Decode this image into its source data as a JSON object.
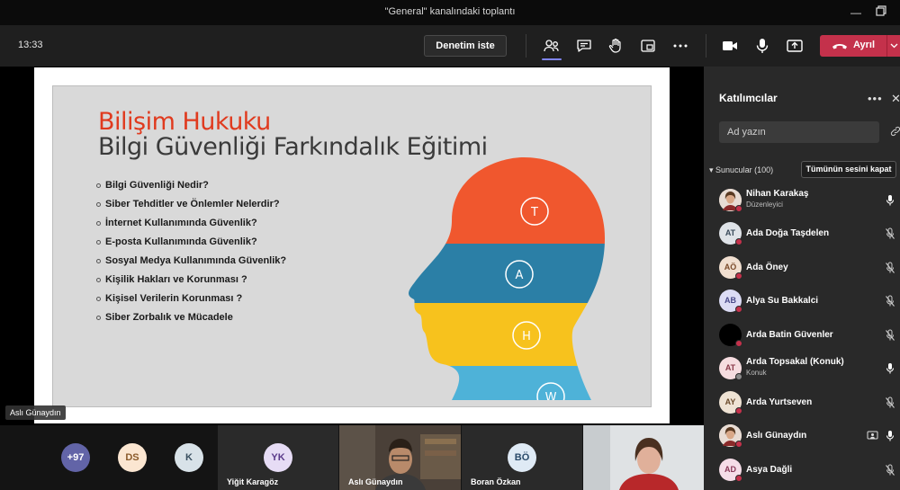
{
  "window": {
    "title": "\"General\" kanalındaki toplantı"
  },
  "toolbar": {
    "time": "13:33",
    "request_control": "Denetim iste",
    "leave": "Ayrıl"
  },
  "slide": {
    "title_line1": "Bilişim Hukuku",
    "title_line2": "Bilgi Güvenliği Farkındalık Eğitimi",
    "bullets": [
      "Bilgi Güvenliği Nedir?",
      "Siber Tehditler ve Önlemler Nelerdir?",
      "İnternet Kullanımında Güvenlik?",
      "E-posta Kullanımında Güvenlik?",
      "Sosyal Medya Kullanımında Güvenlik?",
      "Kişilik Hakları ve Korunması ?",
      "Kişisel Verilerin Korunması ?",
      "Siber Zorbalık ve Mücadele"
    ],
    "letters": [
      "T",
      "A",
      "H",
      "W"
    ],
    "colors": [
      "#f0572e",
      "#2b7fa6",
      "#f7c21d",
      "#4eb2d8"
    ]
  },
  "presenter_label": "Aslı Günaydın",
  "gallery": {
    "overflow": "+97",
    "ds": "DS",
    "k": "K",
    "tiles": [
      {
        "initials": "YK",
        "name": "Yiğit Karagöz"
      },
      {
        "initials": "",
        "name": "Aslı Günaydın"
      },
      {
        "initials": "BÖ",
        "name": "Boran Özkan"
      }
    ]
  },
  "panel": {
    "title": "Katılımcılar",
    "search_placeholder": "Ad yazın",
    "section": "Sunucular (100)",
    "mute_all": "Tümünün sesini kapat",
    "participants": [
      {
        "initials": "",
        "name": "Nihan Karakaş",
        "sub": "Düzenleyici",
        "bg": "#e8d6c8",
        "fg": "#333"
      },
      {
        "initials": "AT",
        "name": "Ada Doğa Taşdelen",
        "sub": "",
        "bg": "#dfe3e8",
        "fg": "#3a4a5a"
      },
      {
        "initials": "AÖ",
        "name": "Ada Öney",
        "sub": "",
        "bg": "#f1dfd0",
        "fg": "#7a4a2a"
      },
      {
        "initials": "AB",
        "name": "Alya Su Bakkalci",
        "sub": "",
        "bg": "#dcdcf5",
        "fg": "#4a4a8a"
      },
      {
        "initials": "",
        "name": "Arda Batin Güvenler",
        "sub": "",
        "bg": "#000000",
        "fg": "#fff"
      },
      {
        "initials": "AT",
        "name": "Arda Topsakal (Konuk)",
        "sub": "Konuk",
        "bg": "#f6dde0",
        "fg": "#8a3a4a"
      },
      {
        "initials": "AY",
        "name": "Arda Yurtseven",
        "sub": "",
        "bg": "#efe3d4",
        "fg": "#6a4a2a"
      },
      {
        "initials": "",
        "name": "Aslı Günaydın",
        "sub": "",
        "bg": "#e8dcd4",
        "fg": "#333"
      },
      {
        "initials": "AD",
        "name": "Asya Dağli",
        "sub": "",
        "bg": "#f5dde8",
        "fg": "#8a3a5a"
      }
    ]
  }
}
